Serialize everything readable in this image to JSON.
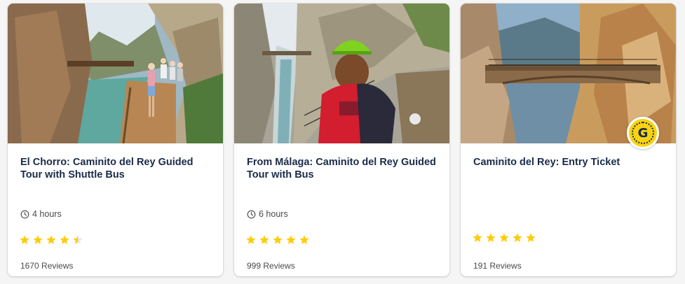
{
  "cards": [
    {
      "title": "El Chorro: Caminito del Rey Guided Tour with Shuttle Bus",
      "duration": "4 hours",
      "rating": 4.5,
      "reviews": "1670 Reviews",
      "image": "cliff-boardwalk-with-hikers-and-turquoise-river"
    },
    {
      "title": "From Málaga: Caminito del Rey Guided Tour with Bus",
      "duration": "6 hours",
      "rating": 5,
      "reviews": "999 Reviews",
      "image": "hiker-in-green-helmet-and-red-jacket-on-gorge-path"
    },
    {
      "title": "Caminito del Rey: Entry Ticket",
      "rating": 5,
      "reviews": "191 Reviews",
      "image": "suspension-bridge-between-gorge-cliffs",
      "badge_icon": "getyourguide-badge-icon"
    }
  ],
  "colors": {
    "title": "#1a2b49",
    "star": "#fdcc0d",
    "badge": "#f9d312",
    "meta": "#4a4a4a"
  }
}
